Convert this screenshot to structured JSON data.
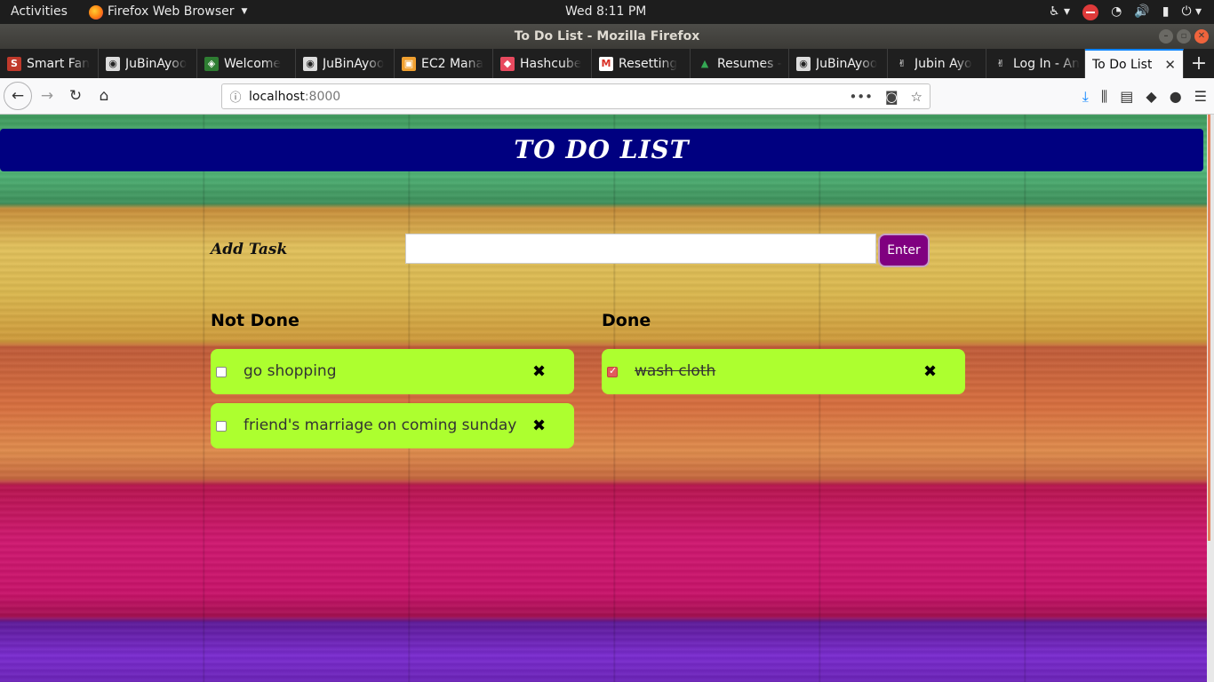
{
  "topbar": {
    "activities": "Activities",
    "app_name": "Firefox Web Browser",
    "clock": "Wed  8:11 PM",
    "tray_icons": [
      "accessibility-icon",
      "stop-icon",
      "wifi-icon",
      "volume-icon",
      "battery-icon",
      "power-icon"
    ]
  },
  "window": {
    "title": "To Do List - Mozilla Firefox"
  },
  "tabs": [
    {
      "label": "Smart Fan",
      "favicon": "S",
      "favicon_color": "#c0392b"
    },
    {
      "label": "JuBinAyoo",
      "favicon": "github-icon",
      "favicon_color": "#222222"
    },
    {
      "label": "Welcome",
      "favicon": "android-icon",
      "favicon_color": "#2e7d32"
    },
    {
      "label": "JuBinAyoo",
      "favicon": "github-icon",
      "favicon_color": "#222222"
    },
    {
      "label": "EC2 Mana",
      "favicon": "aws-icon",
      "favicon_color": "#f0a030"
    },
    {
      "label": "Hashcube",
      "favicon": "hashcube-icon",
      "favicon_color": "#e84a5f"
    },
    {
      "label": "Resetting",
      "favicon": "gmail-icon",
      "favicon_color": "#d93025"
    },
    {
      "label": "Resumes -",
      "favicon": "drive-icon",
      "favicon_color": "#34a853"
    },
    {
      "label": "JuBinAyoo",
      "favicon": "github-icon",
      "favicon_color": "#222222"
    },
    {
      "label": "Jubin Ayo",
      "favicon": "peace-icon",
      "favicon_color": "#ffffff"
    },
    {
      "label": "Log In - An",
      "favicon": "peace-icon",
      "favicon_color": "#ffffff"
    },
    {
      "label": "To Do List",
      "favicon": "",
      "favicon_color": "",
      "active": true
    }
  ],
  "url": {
    "host": "localhost",
    "port": ":8000"
  },
  "page": {
    "header": "TO DO LIST",
    "add_label": "Add Task",
    "input_value": "",
    "enter_label": "Enter",
    "not_done_heading": "Not Done",
    "done_heading": "Done",
    "not_done": [
      {
        "text": "go shopping",
        "checked": false
      },
      {
        "text": "friend's marriage on coming sunday",
        "checked": false
      }
    ],
    "done": [
      {
        "text": "wash cloth",
        "checked": true
      }
    ],
    "delete_glyph": "✖",
    "colors": {
      "header_bg": "#000080",
      "task_bg": "#adff2f",
      "enter_bg": "#800080"
    }
  }
}
